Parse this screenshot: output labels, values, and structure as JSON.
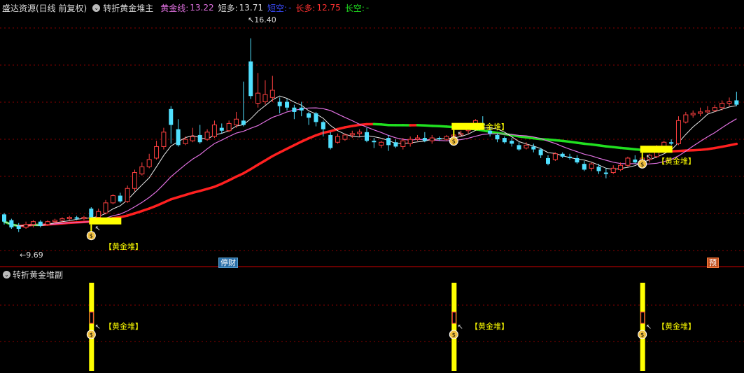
{
  "header": {
    "stock_label": "盛达资源(日线 前复权)",
    "indicator_name": "转折黄金堆主",
    "golden_line": {
      "label": "黄金线:",
      "value": "13.22",
      "color": "#e070e0"
    },
    "short_long": {
      "label": "短多:",
      "value": "13.71",
      "color": "#dddddd"
    },
    "short_empty": {
      "label": "短空:",
      "value": "-",
      "color": "#3a4cff"
    },
    "long_long": {
      "label": "长多:",
      "value": "12.75",
      "color": "#ff3030"
    },
    "long_empty": {
      "label": "长空:",
      "value": "-",
      "color": "#20e020"
    }
  },
  "sub_header": {
    "indicator_name": "转折黄金堆副"
  },
  "annotations": {
    "high_price": "16.40",
    "low_price": "9.69",
    "golden_heap_label": "【黄金堆】",
    "bag_icon": "money-bag-icon",
    "halt_badge": "停财",
    "forecast_badge": "预"
  },
  "colors": {
    "up_candle": "#ff4040",
    "down_candle": "#50e0ff",
    "gold_bar": "#ffff00",
    "grid": "#8b0000",
    "panel_border": "#8b0000"
  },
  "chart_data": {
    "type": "candlestick",
    "price_range": [
      9.0,
      17.0
    ],
    "candles": [
      [
        10.3,
        10.05,
        10.35,
        9.95
      ],
      [
        10.1,
        9.85,
        10.15,
        9.8
      ],
      [
        9.9,
        9.8,
        10.0,
        9.69
      ],
      [
        9.85,
        9.95,
        10.05,
        9.8
      ],
      [
        9.95,
        10.05,
        10.1,
        9.85
      ],
      [
        10.05,
        9.9,
        10.1,
        9.85
      ],
      [
        9.95,
        10.05,
        10.1,
        9.9
      ],
      [
        10.05,
        10.1,
        10.15,
        10.0
      ],
      [
        10.1,
        10.15,
        10.2,
        10.05
      ],
      [
        10.15,
        10.2,
        10.25,
        10.1
      ],
      [
        10.2,
        10.15,
        10.25,
        10.1
      ],
      [
        10.15,
        10.2,
        10.25,
        10.1
      ],
      [
        10.5,
        10.2,
        10.55,
        10.15
      ],
      [
        10.2,
        10.4,
        10.5,
        10.15
      ],
      [
        10.35,
        10.7,
        10.8,
        10.3
      ],
      [
        10.7,
        10.95,
        11.0,
        10.65
      ],
      [
        10.95,
        10.75,
        11.05,
        10.7
      ],
      [
        10.75,
        11.2,
        11.3,
        10.7
      ],
      [
        11.2,
        11.75,
        11.85,
        11.1
      ],
      [
        11.7,
        11.95,
        12.1,
        11.65
      ],
      [
        11.95,
        12.2,
        12.4,
        11.9
      ],
      [
        12.25,
        12.65,
        12.85,
        12.2
      ],
      [
        12.65,
        13.15,
        13.3,
        12.55
      ],
      [
        13.95,
        13.4,
        14.05,
        12.75
      ],
      [
        13.25,
        12.7,
        13.6,
        12.65
      ],
      [
        12.75,
        12.9,
        13.0,
        12.7
      ],
      [
        12.85,
        13.0,
        13.3,
        12.8
      ],
      [
        13.05,
        12.8,
        13.4,
        12.75
      ],
      [
        12.9,
        13.15,
        13.25,
        12.85
      ],
      [
        13.0,
        13.4,
        13.55,
        12.95
      ],
      [
        13.3,
        13.2,
        13.45,
        13.1
      ],
      [
        13.2,
        13.45,
        13.55,
        13.15
      ],
      [
        13.4,
        13.6,
        13.85,
        13.3
      ],
      [
        13.55,
        13.4,
        14.9,
        13.35
      ],
      [
        15.6,
        14.4,
        16.4,
        14.3
      ],
      [
        14.15,
        14.5,
        15.2,
        14.0
      ],
      [
        14.2,
        14.45,
        14.95,
        14.1
      ],
      [
        14.35,
        14.6,
        15.1,
        14.2
      ],
      [
        14.2,
        14.05,
        14.35,
        13.8
      ],
      [
        14.2,
        14.0,
        14.3,
        13.9
      ],
      [
        14.0,
        13.85,
        14.1,
        13.6
      ],
      [
        14.0,
        13.9,
        14.2,
        13.7
      ],
      [
        13.8,
        13.65,
        13.85,
        13.4
      ],
      [
        13.8,
        13.5,
        13.85,
        13.35
      ],
      [
        13.5,
        13.25,
        13.55,
        13.0
      ],
      [
        13.05,
        12.6,
        13.15,
        12.55
      ],
      [
        12.8,
        13.0,
        13.1,
        12.75
      ],
      [
        12.9,
        13.05,
        13.1,
        12.85
      ],
      [
        13.05,
        13.1,
        13.2,
        12.95
      ],
      [
        13.1,
        13.15,
        13.25,
        13.0
      ],
      [
        13.15,
        12.85,
        13.3,
        12.8
      ],
      [
        12.85,
        12.8,
        12.95,
        12.6
      ],
      [
        12.7,
        12.8,
        12.85,
        12.6
      ],
      [
        12.95,
        12.7,
        13.05,
        12.5
      ],
      [
        12.8,
        12.65,
        12.9,
        12.6
      ],
      [
        12.65,
        12.85,
        12.95,
        12.55
      ],
      [
        12.75,
        12.9,
        13.0,
        12.65
      ],
      [
        12.9,
        12.95,
        13.05,
        12.85
      ],
      [
        12.95,
        12.85,
        13.15,
        12.8
      ],
      [
        12.85,
        12.95,
        13.05,
        12.75
      ],
      [
        12.95,
        12.9,
        13.0,
        12.85
      ],
      [
        12.9,
        13.0,
        13.05,
        12.85
      ],
      [
        13.0,
        13.05,
        13.15,
        12.95
      ],
      [
        13.05,
        13.1,
        13.2,
        13.0
      ],
      [
        13.2,
        13.35,
        13.4,
        13.1
      ],
      [
        13.3,
        13.55,
        13.6,
        13.25
      ],
      [
        13.45,
        13.4,
        13.7,
        13.3
      ],
      [
        13.2,
        13.1,
        13.3,
        13.0
      ],
      [
        13.05,
        12.9,
        13.1,
        12.8
      ],
      [
        12.95,
        12.8,
        13.0,
        12.75
      ],
      [
        12.85,
        12.75,
        12.95,
        12.65
      ],
      [
        12.7,
        12.55,
        12.8,
        12.5
      ],
      [
        12.6,
        12.7,
        12.8,
        12.55
      ],
      [
        12.65,
        12.55,
        12.75,
        12.45
      ],
      [
        12.55,
        12.35,
        12.6,
        12.25
      ],
      [
        12.25,
        12.05,
        12.35,
        12.0
      ],
      [
        12.2,
        12.4,
        12.45,
        12.15
      ],
      [
        12.4,
        12.3,
        12.45,
        12.25
      ],
      [
        12.3,
        12.25,
        12.4,
        12.2
      ],
      [
        12.25,
        12.1,
        12.35,
        12.05
      ],
      [
        12.05,
        11.85,
        12.15,
        11.8
      ],
      [
        11.9,
        12.05,
        12.1,
        11.8
      ],
      [
        11.95,
        11.8,
        12.05,
        11.7
      ],
      [
        11.75,
        11.7,
        11.9,
        11.55
      ],
      [
        11.75,
        11.9,
        12.0,
        11.7
      ],
      [
        11.85,
        12.0,
        12.1,
        11.8
      ],
      [
        12.0,
        12.25,
        12.3,
        11.95
      ],
      [
        12.2,
        12.1,
        12.35,
        12.05
      ],
      [
        12.1,
        12.25,
        12.3,
        12.05
      ],
      [
        12.2,
        12.35,
        12.4,
        12.1
      ],
      [
        12.3,
        12.5,
        12.7,
        12.25
      ],
      [
        12.5,
        12.8,
        12.85,
        12.45
      ],
      [
        12.8,
        12.75,
        12.9,
        12.7
      ],
      [
        12.75,
        13.55,
        13.7,
        12.7
      ],
      [
        13.5,
        13.75,
        13.85,
        13.45
      ],
      [
        13.75,
        13.8,
        13.9,
        13.65
      ],
      [
        13.8,
        13.85,
        14.0,
        13.7
      ],
      [
        13.85,
        13.9,
        14.05,
        13.8
      ],
      [
        13.9,
        14.0,
        14.1,
        13.85
      ],
      [
        14.0,
        14.15,
        14.25,
        13.9
      ],
      [
        14.15,
        14.2,
        14.35,
        14.05
      ],
      [
        14.25,
        14.1,
        14.55,
        14.05
      ]
    ]
  }
}
